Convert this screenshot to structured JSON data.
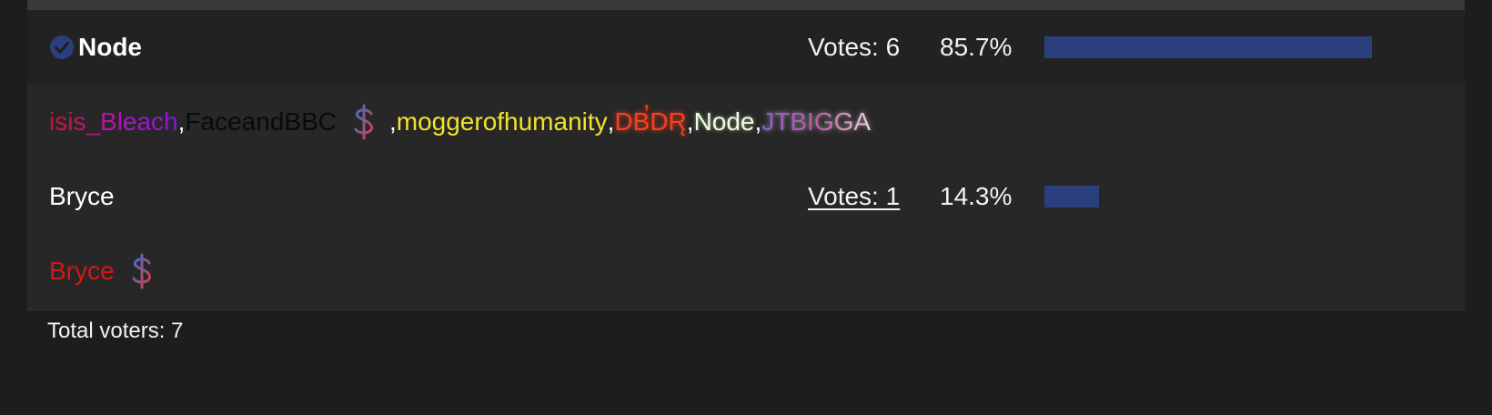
{
  "colors": {
    "bar": "#2b3f7c",
    "check": "#2b3f7c"
  },
  "options": [
    {
      "name": "Node",
      "selected": true,
      "votes_label": "Votes: 6",
      "percent_label": "85.7%",
      "percent": 85.7,
      "voters": [
        {
          "name": "isis_Bleach",
          "badge": null
        },
        {
          "name": "FaceandBBC",
          "badge": "dollar-icon"
        },
        {
          "name": "moggerofhumanity",
          "badge": null
        },
        {
          "name": "DB̕DR̨",
          "badge": null
        },
        {
          "name": "Node",
          "badge": null
        },
        {
          "name": "JTBIGGA",
          "badge": null
        }
      ]
    },
    {
      "name": "Bryce",
      "selected": false,
      "votes_label": "Votes: 1",
      "percent_label": "14.3%",
      "percent": 14.3,
      "voters": [
        {
          "name": "Bryce",
          "badge": "dollar-icon"
        }
      ]
    }
  ],
  "separator": ", ",
  "total_label": "Total voters: 7"
}
